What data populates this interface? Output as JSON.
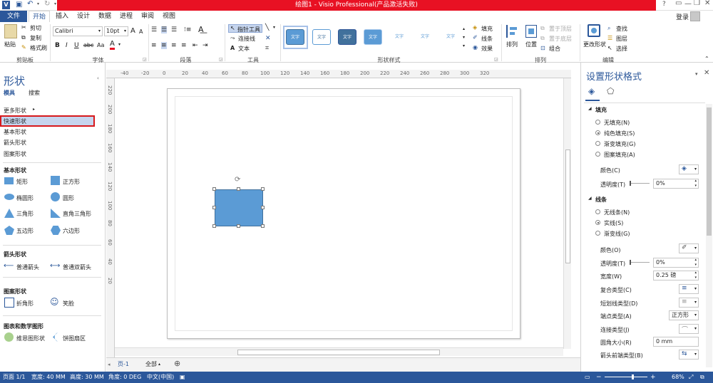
{
  "app": {
    "title": "绘图1 - Visio Professional(产品激活失败)",
    "login": "登录"
  },
  "tabs": {
    "file": "文件",
    "home": "开始",
    "insert": "插入",
    "design": "设计",
    "data": "数据",
    "process": "进程",
    "review": "审阅",
    "view": "视图"
  },
  "ribbon": {
    "clipboard": {
      "paste": "粘贴",
      "cut": "剪切",
      "copy": "复制",
      "format_painter": "格式刷",
      "label": "剪贴板"
    },
    "font": {
      "family": "Calibri",
      "size": "10pt",
      "label": "字体",
      "bold": "B",
      "italic": "I",
      "underline": "U",
      "strike": "abc",
      "color": "A",
      "grow": "A",
      "shrink": "A",
      "case": "Aa"
    },
    "paragraph": {
      "label": "段落"
    },
    "tools": {
      "pointer": "指针工具",
      "connector": "连接线",
      "text": "文本",
      "label": "工具"
    },
    "shape_styles": {
      "label": "形状样式",
      "sample": "文字",
      "fill": "填充",
      "line": "线条",
      "effects": "效果"
    },
    "arrange": {
      "label": "排列",
      "arrange": "排列",
      "position": "位置",
      "bring_front": "置于顶层",
      "send_back": "置于底层",
      "group": "组合"
    },
    "editing": {
      "label": "编辑",
      "change_shape": "更改形状",
      "find": "查找",
      "layers": "图层",
      "select": "选择"
    }
  },
  "left": {
    "title": "形状",
    "tab_stencils": "模具",
    "tab_search": "搜索",
    "more": "更多形状",
    "items": [
      "快速形状",
      "基本形状",
      "箭头形状",
      "图案形状"
    ],
    "basic_head": "基本形状",
    "basic": [
      "矩形",
      "正方形",
      "椭圆形",
      "圆形",
      "三角形",
      "直角三角形",
      "五边形",
      "六边形"
    ],
    "arrow_head": "箭头形状",
    "arrows": [
      "普通箭头",
      "普通双箭头"
    ],
    "pattern_head": "图案形状",
    "patterns": [
      "折角形",
      "笑脸"
    ],
    "chart_head": "图表和数学图形",
    "charts": [
      "维恩图形状",
      "饼图扇区"
    ]
  },
  "ruler": {
    "h": [
      "-40",
      "-20",
      "0",
      "20",
      "40",
      "60",
      "80",
      "100",
      "120",
      "140",
      "160",
      "180",
      "200",
      "220",
      "240",
      "260",
      "280",
      "300",
      "320"
    ],
    "v": [
      "220",
      "200",
      "180",
      "160",
      "140",
      "120",
      "100",
      "80",
      "60",
      "40",
      "20"
    ]
  },
  "page": {
    "tab": "页-1",
    "all": "全部"
  },
  "right": {
    "title": "设置形状格式",
    "fill_head": "填充",
    "fill_opts": [
      "无填充(N)",
      "纯色填充(S)",
      "渐变填充(G)",
      "图案填充(A)"
    ],
    "color": "颜色(C)",
    "transparency": "透明度(T)",
    "transparency_val": "0%",
    "line_head": "线条",
    "line_opts": [
      "无线条(N)",
      "实线(S)",
      "渐变线(G)"
    ],
    "line_color": "颜色(O)",
    "line_transparency": "透明度(T)",
    "line_transparency_val": "0%",
    "width": "宽度(W)",
    "width_val": "0.25 磅",
    "compound": "复合类型(C)",
    "dash": "短划线类型(D)",
    "cap": "端点类型(A)",
    "cap_val": "正方形",
    "join": "连接类型(J)",
    "rounding": "圆角大小(R)",
    "rounding_val": "0 mm",
    "begin_arrow": "箭头前端类型(B)"
  },
  "status": {
    "page": "页面 1/1",
    "width": "宽度: 40 MM",
    "height": "高度: 30 MM",
    "angle": "角度: 0 DEG",
    "lang": "中文(中国)",
    "zoom": "68%"
  },
  "colors": {
    "accent": "#2b579a",
    "shape": "#5b9bd5",
    "title_red": "#e81123",
    "highlight": "#c6d5ee",
    "red_box": "#d7191c"
  }
}
